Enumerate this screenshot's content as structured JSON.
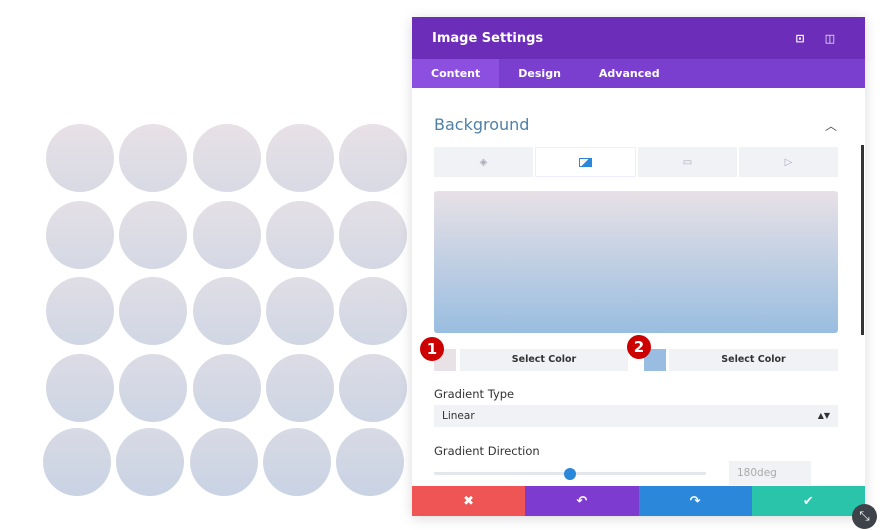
{
  "panel": {
    "title": "Image Settings",
    "tabs": [
      "Content",
      "Design",
      "Advanced"
    ],
    "active_tab": "Content"
  },
  "section": {
    "title": "Background"
  },
  "background_tabs": [
    "color",
    "gradient",
    "image",
    "video"
  ],
  "gradient": {
    "start_color": "#e8e1e6",
    "end_color": "#99bde0",
    "select_color_1": "Select Color",
    "select_color_2": "Select Color",
    "badge_1": "1",
    "badge_2": "2",
    "type_label": "Gradient Type",
    "type_value": "Linear",
    "direction_label": "Gradient Direction",
    "direction_value": "180deg",
    "direction_fraction": 0.5
  },
  "footer": {
    "cancel": "✖",
    "undo": "↶",
    "redo": "↷",
    "save": "✔"
  },
  "colors": {
    "header": "#6c2eb9",
    "tabs": "#7b3fd0",
    "cancel": "#ef5555",
    "undo": "#7e3bd0",
    "redo": "#2b87da",
    "save": "#29c4a9"
  }
}
